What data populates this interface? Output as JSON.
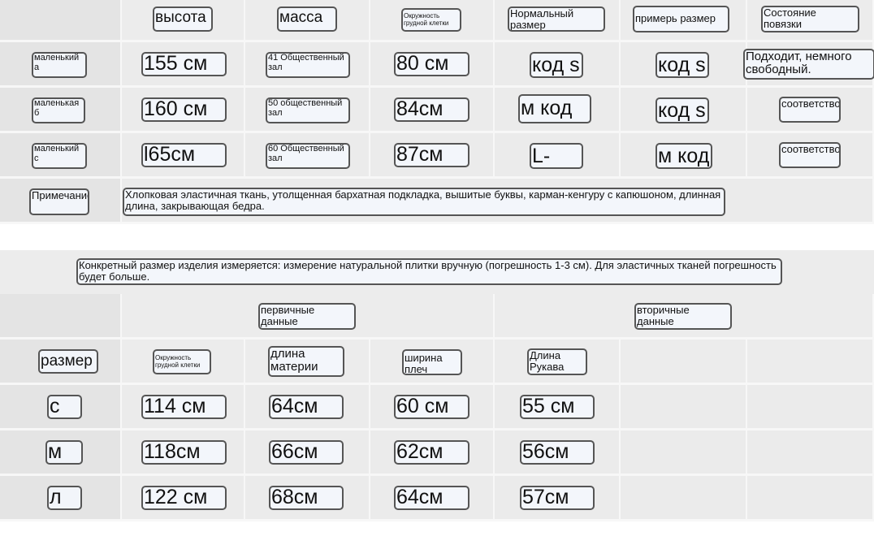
{
  "size_table": {
    "headers": [
      "высота",
      "масса",
      "Окружность грудной клетки",
      "Нормальный размер",
      "примерь размер",
      "Состояние повязки"
    ],
    "rows": [
      {
        "label": "маленький а",
        "values": [
          "155 см",
          "41 Общественный зал",
          "80 см",
          "код s",
          "код s",
          "Подходит, немного свободный."
        ]
      },
      {
        "label": "маленькая б",
        "values": [
          "160 см",
          "50 общественный зал",
          "84см",
          "м код",
          "код s",
          "соответствовать"
        ]
      },
      {
        "label": "маленький с",
        "values": [
          "l65см",
          "60 Общественный зал",
          "87см",
          "L-код",
          "м код",
          "соответствовать"
        ]
      }
    ],
    "note_label": "Примечание",
    "note_text": "Хлопковая эластичная ткань, утолщенная бархатная подкладка, вышитые буквы, карман-кенгуру с капюшоном, длинная длина, закрывающая бедра."
  },
  "measure_note": "Конкретный размер изделия измеряется: измерение натуральной плитки вручную (погрешность 1-3 см). Для эластичных тканей погрешность будет больше.",
  "measure_table": {
    "primary_label": "первичные данные",
    "secondary_label": "вторичные данные",
    "headers": [
      "размер",
      "Окружность грудной клетки",
      "длина материи",
      "ширина плеч",
      "Длина Рукава"
    ],
    "rows": [
      {
        "size": "с",
        "values": [
          "114 см",
          "64см",
          "60 см",
          "55 см"
        ]
      },
      {
        "size": "м",
        "values": [
          "118см",
          "66см",
          "62см",
          "56см"
        ]
      },
      {
        "size": "л",
        "values": [
          "122 см",
          "68см",
          "64см",
          "57см"
        ]
      }
    ]
  }
}
